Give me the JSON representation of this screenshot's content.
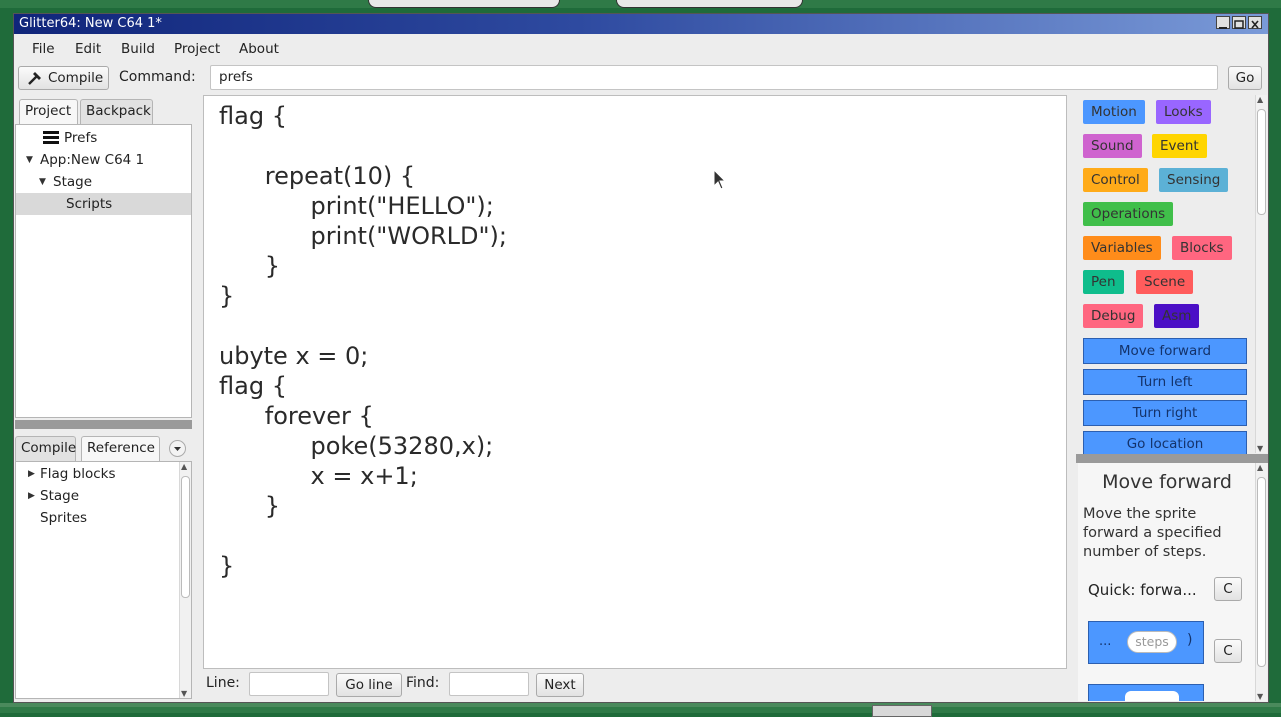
{
  "window": {
    "title": "Glitter64: New C64 1*"
  },
  "menu": [
    "File",
    "Edit",
    "Build",
    "Project",
    "About"
  ],
  "toolbar": {
    "compile_label": "Compile",
    "command_label": "Command:",
    "command_value": "prefs",
    "go_label": "Go"
  },
  "project_panel": {
    "tabs": [
      "Project",
      "Backpack"
    ],
    "tree": {
      "prefs": "Prefs",
      "app": "App:New C64 1",
      "stage": "Stage",
      "scripts": "Scripts"
    }
  },
  "reference_panel": {
    "tabs": [
      "Compile",
      "Reference"
    ],
    "tree": {
      "flag_blocks": "Flag blocks",
      "stage": "Stage",
      "sprites": "Sprites"
    }
  },
  "editor": {
    "lines": [
      "flag {",
      "",
      "      repeat(10) {",
      "            print(\"HELLO\");",
      "            print(\"WORLD\");",
      "      }",
      "}",
      "",
      "ubyte x = 0;",
      "flag {",
      "      forever {",
      "            poke(53280,x);",
      "            x = x+1;",
      "      }",
      "",
      "}"
    ]
  },
  "findbar": {
    "line_label": "Line:",
    "line_value": "",
    "goline_label": "Go line",
    "find_label": "Find:",
    "find_value": "",
    "next_label": "Next"
  },
  "palette": {
    "categories": {
      "motion": "Motion",
      "looks": "Looks",
      "sound": "Sound",
      "event": "Event",
      "control": "Control",
      "sensing": "Sensing",
      "operations": "Operations",
      "variables": "Variables",
      "blocks": "Blocks",
      "pen": "Pen",
      "scene": "Scene",
      "debug": "Debug",
      "asm": "Asm"
    },
    "colors": {
      "motion": "#4c97ff",
      "looks": "#9966ff",
      "sound": "#cf63cf",
      "event": "#ffd500",
      "control": "#ffab19",
      "sensing": "#5cb1d6",
      "operations": "#40bf4a",
      "variables": "#ff8c1a",
      "blocks": "#ff6680",
      "pen": "#0fbd8c",
      "scene": "#ff5c5c",
      "debug": "#ff6680",
      "asm": "#4b0fc6"
    },
    "blocks": [
      "Move forward",
      "Turn left",
      "Turn right",
      "Go location"
    ]
  },
  "help": {
    "title": "Move forward",
    "description": "Move the sprite forward a specified number of steps.",
    "quick_label": "Quick: forwa...",
    "copy_label": "C",
    "block_prefix": "...",
    "block_placeholder": "steps",
    "block_suffix": ")"
  }
}
